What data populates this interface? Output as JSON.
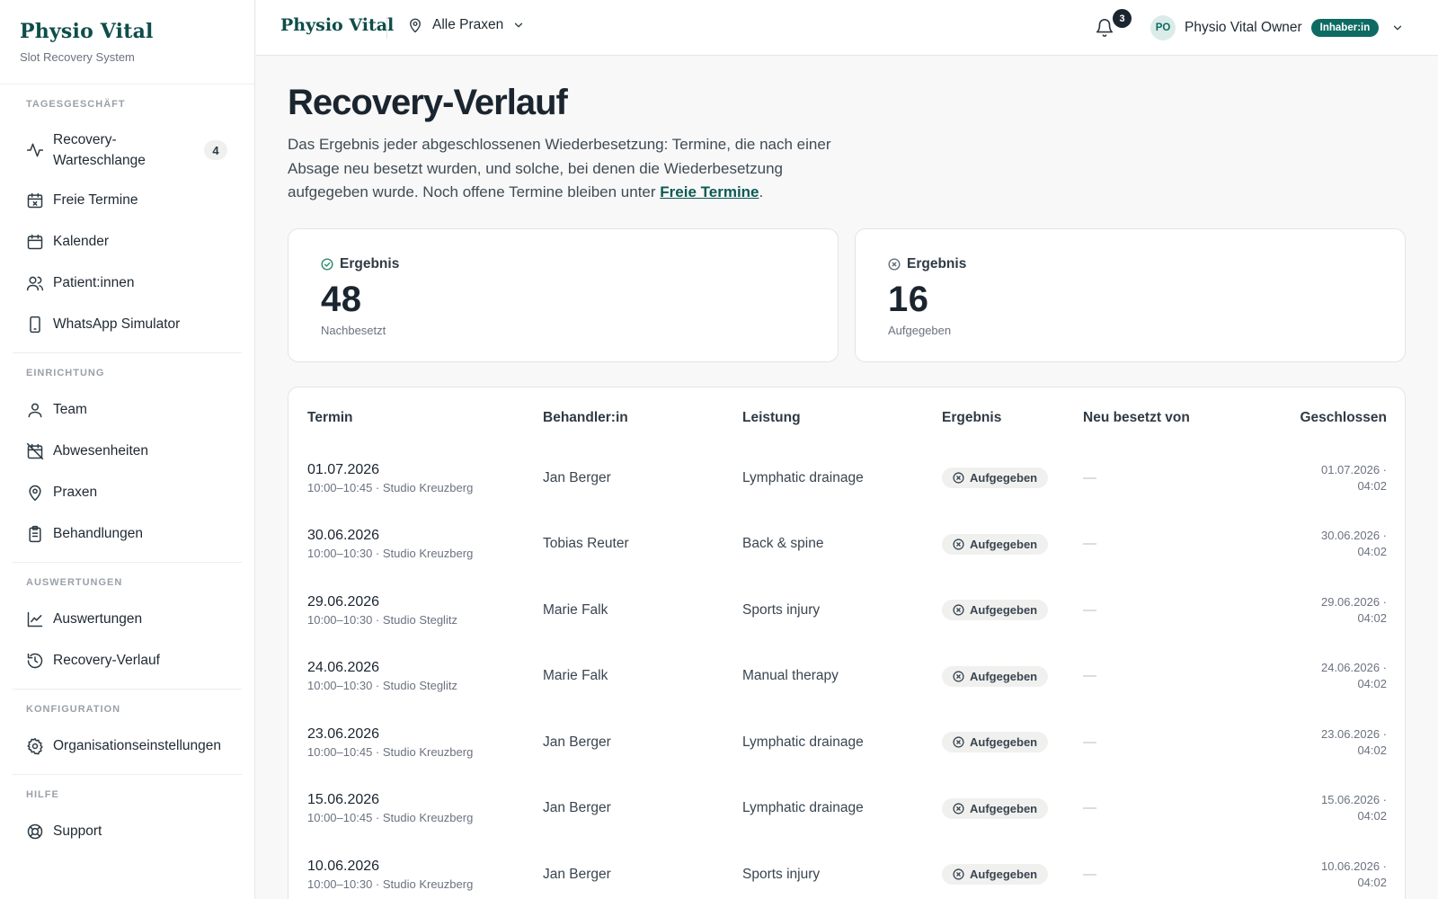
{
  "sidebar": {
    "brand": "Physio Vital",
    "subtitle": "Slot Recovery System",
    "sections": {
      "tages": "TAGESGESCHÄFT",
      "einrichtung": "EINRICHTUNG",
      "auswertungen": "AUSWERTUNGEN",
      "konfiguration": "KONFIGURATION",
      "hilfe": "HILFE"
    },
    "items": {
      "recovery_queue": "Recovery-Warteschlange",
      "recovery_queue_count": "4",
      "freie_termine": "Freie Termine",
      "kalender": "Kalender",
      "patienten": "Patient:innen",
      "whatsapp": "WhatsApp Simulator",
      "team": "Team",
      "abwesenheiten": "Abwesenheiten",
      "praxen": "Praxen",
      "behandlungen": "Behandlungen",
      "auswertungen": "Auswertungen",
      "recovery_verlauf": "Recovery-Verlauf",
      "org_settings": "Organisationseinstellungen",
      "support": "Support"
    }
  },
  "topbar": {
    "brand": "Physio Vital",
    "location": "Alle Praxen",
    "notifications": "3",
    "avatar_initials": "PO",
    "user_name": "Physio Vital Owner",
    "role": "Inhaber:in"
  },
  "page": {
    "title": "Recovery-Verlauf",
    "desc_before": "Das Ergebnis jeder abgeschlossenen Wiederbesetzung: Termine, die nach einer Absage neu besetzt wurden, und solche, bei denen die Wiederbesetzung aufgegeben wurde. Noch offene Termine bleiben unter ",
    "desc_link": "Freie Termine",
    "desc_after": "."
  },
  "stats": [
    {
      "label": "Ergebnis",
      "value": "48",
      "sub": "Nachbesetzt"
    },
    {
      "label": "Ergebnis",
      "value": "16",
      "sub": "Aufgegeben"
    }
  ],
  "table": {
    "headers": {
      "termin": "Termin",
      "behandler": "Behandler:in",
      "leistung": "Leistung",
      "ergebnis": "Ergebnis",
      "neu": "Neu besetzt von",
      "geschlossen": "Geschlossen"
    },
    "rows": [
      {
        "date": "01.07.2026",
        "time": "10:00–10:45 · Studio Kreuzberg",
        "therapist": "Jan Berger",
        "service": "Lymphatic drainage",
        "result": "Aufgegeben",
        "refilled_by": "—",
        "closed_date": "01.07.2026 ·",
        "closed_time": "04:02"
      },
      {
        "date": "30.06.2026",
        "time": "10:00–10:30 · Studio Kreuzberg",
        "therapist": "Tobias Reuter",
        "service": "Back & spine",
        "result": "Aufgegeben",
        "refilled_by": "—",
        "closed_date": "30.06.2026 ·",
        "closed_time": "04:02"
      },
      {
        "date": "29.06.2026",
        "time": "10:00–10:30 · Studio Steglitz",
        "therapist": "Marie Falk",
        "service": "Sports injury",
        "result": "Aufgegeben",
        "refilled_by": "—",
        "closed_date": "29.06.2026 ·",
        "closed_time": "04:02"
      },
      {
        "date": "24.06.2026",
        "time": "10:00–10:30 · Studio Steglitz",
        "therapist": "Marie Falk",
        "service": "Manual therapy",
        "result": "Aufgegeben",
        "refilled_by": "—",
        "closed_date": "24.06.2026 ·",
        "closed_time": "04:02"
      },
      {
        "date": "23.06.2026",
        "time": "10:00–10:45 · Studio Kreuzberg",
        "therapist": "Jan Berger",
        "service": "Lymphatic drainage",
        "result": "Aufgegeben",
        "refilled_by": "—",
        "closed_date": "23.06.2026 ·",
        "closed_time": "04:02"
      },
      {
        "date": "15.06.2026",
        "time": "10:00–10:45 · Studio Kreuzberg",
        "therapist": "Jan Berger",
        "service": "Lymphatic drainage",
        "result": "Aufgegeben",
        "refilled_by": "—",
        "closed_date": "15.06.2026 ·",
        "closed_time": "04:02"
      },
      {
        "date": "10.06.2026",
        "time": "10:00–10:30 · Studio Kreuzberg",
        "therapist": "Jan Berger",
        "service": "Sports injury",
        "result": "Aufgegeben",
        "refilled_by": "—",
        "closed_date": "10.06.2026 ·",
        "closed_time": "04:02"
      }
    ]
  },
  "colors": {
    "brand": "#0e4d4a",
    "accent": "#0e6b63",
    "success_icon": "#2e8b6a"
  }
}
